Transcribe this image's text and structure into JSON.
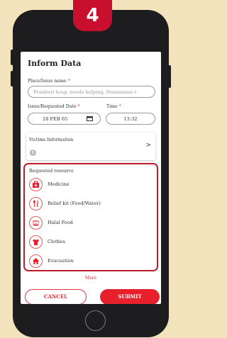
{
  "step_badge": "4",
  "form": {
    "title": "Inform Data",
    "place": {
      "label": "Place/Issue name",
      "required_mark": "*",
      "placeholder": "Pranburi hosp. needs helping, Donnamsai v"
    },
    "date": {
      "label": "Issue/Requested Date",
      "required_mark": "*",
      "value": "28 FEB 65",
      "icon": "calendar-icon"
    },
    "time": {
      "label": "Time",
      "required_mark": "*",
      "value": "13:32"
    },
    "victims": {
      "title": "Victims Information",
      "icon": "info-icon",
      "info_glyph": "i",
      "chevron": ">"
    },
    "resources": {
      "title": "Requested resource",
      "items": [
        {
          "label": "Medicine",
          "icon": "medicine-bag-icon"
        },
        {
          "label": "Relief kit (Food/Water)",
          "icon": "fork-knife-icon"
        },
        {
          "label": "Halal Food",
          "icon": "halal-icon"
        },
        {
          "label": "Clothes",
          "icon": "shirt-icon"
        },
        {
          "label": "Evacuation",
          "icon": "house-icon"
        }
      ]
    },
    "more_label": "More",
    "cancel_label": "CANCEL",
    "submit_label": "SUBMIT"
  },
  "colors": {
    "accent_red": "#e8202c",
    "highlight_border": "#bf1d2b",
    "background": "#f3e3bc",
    "phone_body": "#1d1d1f"
  }
}
